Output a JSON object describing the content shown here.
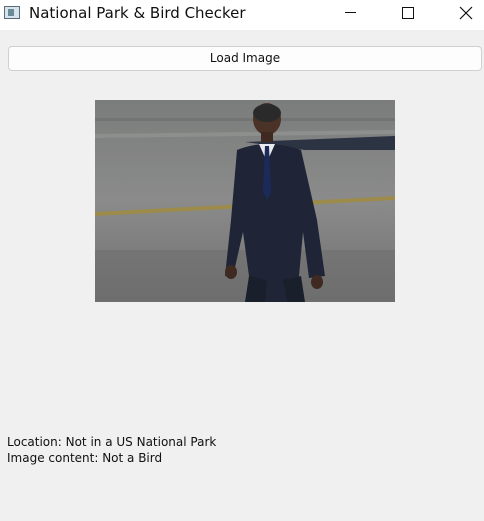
{
  "window": {
    "title": "National Park & Bird Checker",
    "icon": "app-window-icon"
  },
  "controls": {
    "minimize": "minimize-icon",
    "maximize": "maximize-icon",
    "close": "close-icon"
  },
  "toolbar": {
    "load_label": "Load Image"
  },
  "preview": {
    "description_icon": "photo"
  },
  "results": {
    "location": "Location: Not in a US National Park",
    "content": "Image content: Not a Bird"
  }
}
